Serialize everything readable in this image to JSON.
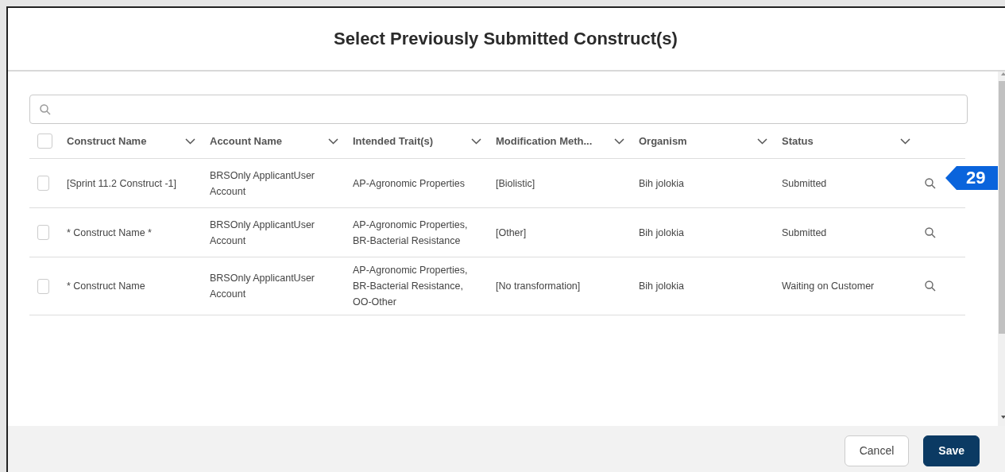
{
  "modal": {
    "title": "Select Previously Submitted Construct(s)"
  },
  "table": {
    "select_all": {
      "checked": false
    },
    "columns": [
      "Construct Name",
      "Account Name",
      "Intended Trait(s)",
      "Modification Meth...",
      "Organism",
      "Status"
    ],
    "rows": [
      {
        "checked": false,
        "cells": [
          "[Sprint 11.2 Construct -1]",
          "BRSOnly ApplicantUser Account",
          "AP-Agronomic Properties",
          "[Biolistic]",
          "Bih jolokia",
          "Submitted"
        ]
      },
      {
        "checked": false,
        "cells": [
          "* Construct Name *",
          "BRSOnly ApplicantUser Account",
          "AP-Agronomic Properties, BR-Bacterial Resistance",
          "[Other]",
          "Bih jolokia",
          "Submitted"
        ]
      },
      {
        "checked": false,
        "cells": [
          "* Construct Name",
          "BRSOnly ApplicantUser Account",
          "AP-Agronomic Properties, BR-Bacterial Resistance, OO-Other",
          "[No transformation]",
          "Bih jolokia",
          "Waiting on Customer"
        ]
      }
    ]
  },
  "callout": {
    "text": "29"
  },
  "footer": {
    "buttons": [
      {
        "label": "Cancel",
        "kind": "secondary"
      },
      {
        "label": "Save",
        "kind": "primary"
      }
    ]
  }
}
